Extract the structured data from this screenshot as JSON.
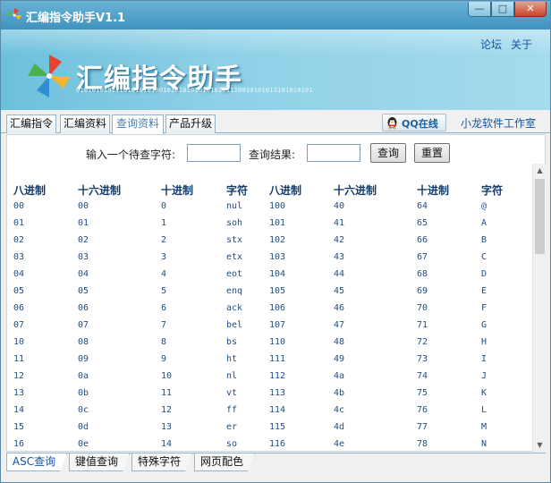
{
  "window": {
    "title": "汇编指令助手V1.1",
    "controls": {
      "minimize": "—",
      "maximize": "□",
      "close": "✕"
    }
  },
  "banner": {
    "title": "汇编指令助手",
    "binary_text": "010101010111010101010010101010101010101110010101011101010101",
    "links": {
      "forum": "论坛",
      "about": "关于"
    }
  },
  "tabs": [
    {
      "label": "汇编指令",
      "active": false
    },
    {
      "label": "汇编资料",
      "active": false
    },
    {
      "label": "查询资料",
      "active": true
    },
    {
      "label": "产品升级",
      "active": false
    }
  ],
  "qq_button": "QQ在线",
  "studio_link": "小龙软件工作室",
  "query": {
    "input_label": "输入一个待查字符:",
    "input_value": "",
    "result_label": "查询结果:",
    "result_value": "",
    "search_button": "查询",
    "reset_button": "重置"
  },
  "table": {
    "headers": [
      "八进制",
      "十六进制",
      "十进制",
      "字符",
      "八进制",
      "十六进制",
      "十进制",
      "字符"
    ],
    "rows": [
      [
        "00",
        "00",
        "0",
        "nul",
        "100",
        "40",
        "64",
        "@"
      ],
      [
        "01",
        "01",
        "1",
        "soh",
        "101",
        "41",
        "65",
        "A"
      ],
      [
        "02",
        "02",
        "2",
        "stx",
        "102",
        "42",
        "66",
        "B"
      ],
      [
        "03",
        "03",
        "3",
        "etx",
        "103",
        "43",
        "67",
        "C"
      ],
      [
        "04",
        "04",
        "4",
        "eot",
        "104",
        "44",
        "68",
        "D"
      ],
      [
        "05",
        "05",
        "5",
        "enq",
        "105",
        "45",
        "69",
        "E"
      ],
      [
        "06",
        "06",
        "6",
        "ack",
        "106",
        "46",
        "70",
        "F"
      ],
      [
        "07",
        "07",
        "7",
        "bel",
        "107",
        "47",
        "71",
        "G"
      ],
      [
        "10",
        "08",
        "8",
        "bs",
        "110",
        "48",
        "72",
        "H"
      ],
      [
        "11",
        "09",
        "9",
        "ht",
        "111",
        "49",
        "73",
        "I"
      ],
      [
        "12",
        "0a",
        "10",
        "nl",
        "112",
        "4a",
        "74",
        "J"
      ],
      [
        "13",
        "0b",
        "11",
        "vt",
        "113",
        "4b",
        "75",
        "K"
      ],
      [
        "14",
        "0c",
        "12",
        "ff",
        "114",
        "4c",
        "76",
        "L"
      ],
      [
        "15",
        "0d",
        "13",
        "er",
        "115",
        "4d",
        "77",
        "M"
      ],
      [
        "16",
        "0e",
        "14",
        "so",
        "116",
        "4e",
        "78",
        "N"
      ]
    ]
  },
  "bottom_tabs": [
    {
      "label": "ASC查询",
      "active": true
    },
    {
      "label": "键值查询",
      "active": false
    },
    {
      "label": "特殊字符",
      "active": false
    },
    {
      "label": "网页配色",
      "active": false
    }
  ],
  "colors": {
    "title_gradient_top": "#6ab3d6",
    "banner": "#8fd0e6",
    "link": "#1355a3",
    "table_text": "#1f4e82",
    "header_text": "#123c6a"
  }
}
